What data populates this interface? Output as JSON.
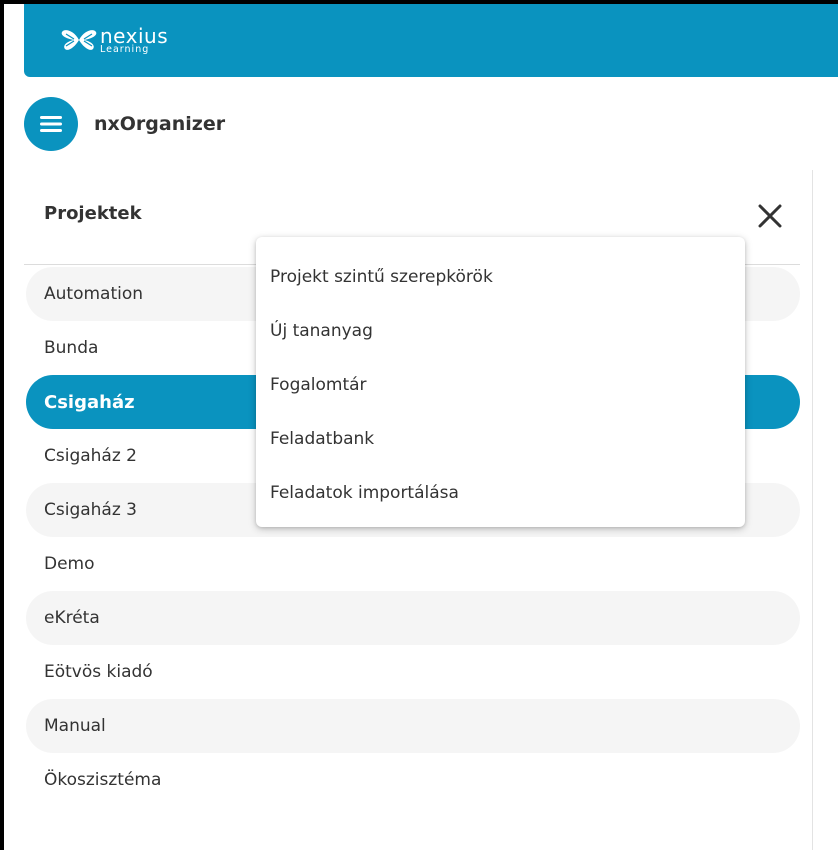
{
  "brand": {
    "icon": "butterfly-logo-icon",
    "word": "nexius",
    "sub": "Learning",
    "color": "#0a93bf"
  },
  "app": {
    "menu_icon": "hamburger-menu-icon",
    "title": "nxOrganizer"
  },
  "panel": {
    "title": "Projektek",
    "close_icon": "close-icon"
  },
  "projects": [
    {
      "label": "Automation",
      "style": "alt"
    },
    {
      "label": "Bunda",
      "style": "plain"
    },
    {
      "label": "Csigaház",
      "style": "active"
    },
    {
      "label": "Csigaház 2",
      "style": "plain"
    },
    {
      "label": "Csigaház 3",
      "style": "alt"
    },
    {
      "label": "Demo",
      "style": "plain"
    },
    {
      "label": "eKréta",
      "style": "alt"
    },
    {
      "label": "Eötvös kiadó",
      "style": "plain"
    },
    {
      "label": "Manual",
      "style": "alt"
    },
    {
      "label": "Ökoszisztéma",
      "style": "plain"
    }
  ],
  "context_menu": {
    "items": [
      "Projekt szintű szerepkörök",
      "Új tananyag",
      "Fogalomtár",
      "Feladatbank",
      "Feladatok importálása"
    ]
  }
}
